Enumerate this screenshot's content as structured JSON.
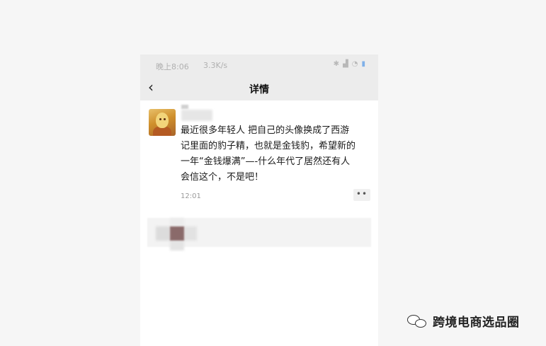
{
  "status_bar": {
    "time": "晚上8:06",
    "speed": "3.3K/s",
    "icons": [
      "bluetooth-icon",
      "signal-icon",
      "wifi-icon",
      "battery-icon"
    ]
  },
  "nav": {
    "back_icon": "‹",
    "title": "详情"
  },
  "post": {
    "lines": [
      "最近很多年轻人 把自己的头像换成了西游",
      "记里面的豹子精，也就是金钱豹，希望新的",
      "一年“金钱爆满”—-什么年代了居然还有人",
      "会信这个，不是吧！"
    ],
    "time": "12:01",
    "more_label": "••"
  },
  "watermark": {
    "text": "跨境电商选品圈"
  },
  "colors": {
    "statusbar_bg": "#ececec",
    "page_bg": "#f6f6f6",
    "card_bg": "#ffffff",
    "battery": "#7fb0e8"
  }
}
